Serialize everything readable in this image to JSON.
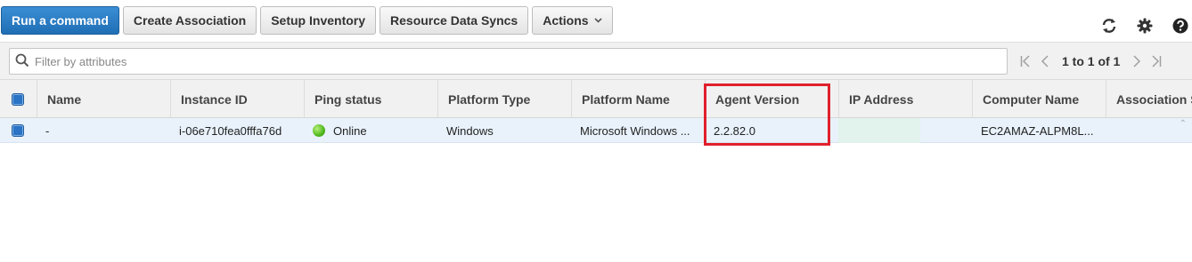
{
  "toolbar": {
    "run_command": "Run a command",
    "create_association": "Create Association",
    "setup_inventory": "Setup Inventory",
    "resource_data_syncs": "Resource Data Syncs",
    "actions": "Actions"
  },
  "filter": {
    "placeholder": "Filter by attributes"
  },
  "pager": {
    "text": "1 to 1 of 1"
  },
  "table": {
    "columns": [
      "Name",
      "Instance ID",
      "Ping status",
      "Platform Type",
      "Platform Name",
      "Agent Version",
      "IP Address",
      "Computer Name",
      "Association S"
    ],
    "rows": [
      {
        "name": "-",
        "instance_id": "i-06e710fea0fffa76d",
        "ping_status": "Online",
        "platform_type": "Windows",
        "platform_name": "Microsoft Windows ...",
        "agent_version": "2.2.82.0",
        "ip_address": "",
        "computer_name": "EC2AMAZ-ALPM8L..."
      }
    ]
  },
  "colors": {
    "primary": "#1f6eb5",
    "highlight": "#e0202c",
    "online": "#4fb81d",
    "selected_row": "#e9f2fb"
  },
  "icons": [
    "refresh-icon",
    "gear-icon",
    "help-icon",
    "search-icon",
    "first-page-icon",
    "prev-page-icon",
    "next-page-icon",
    "last-page-icon"
  ]
}
